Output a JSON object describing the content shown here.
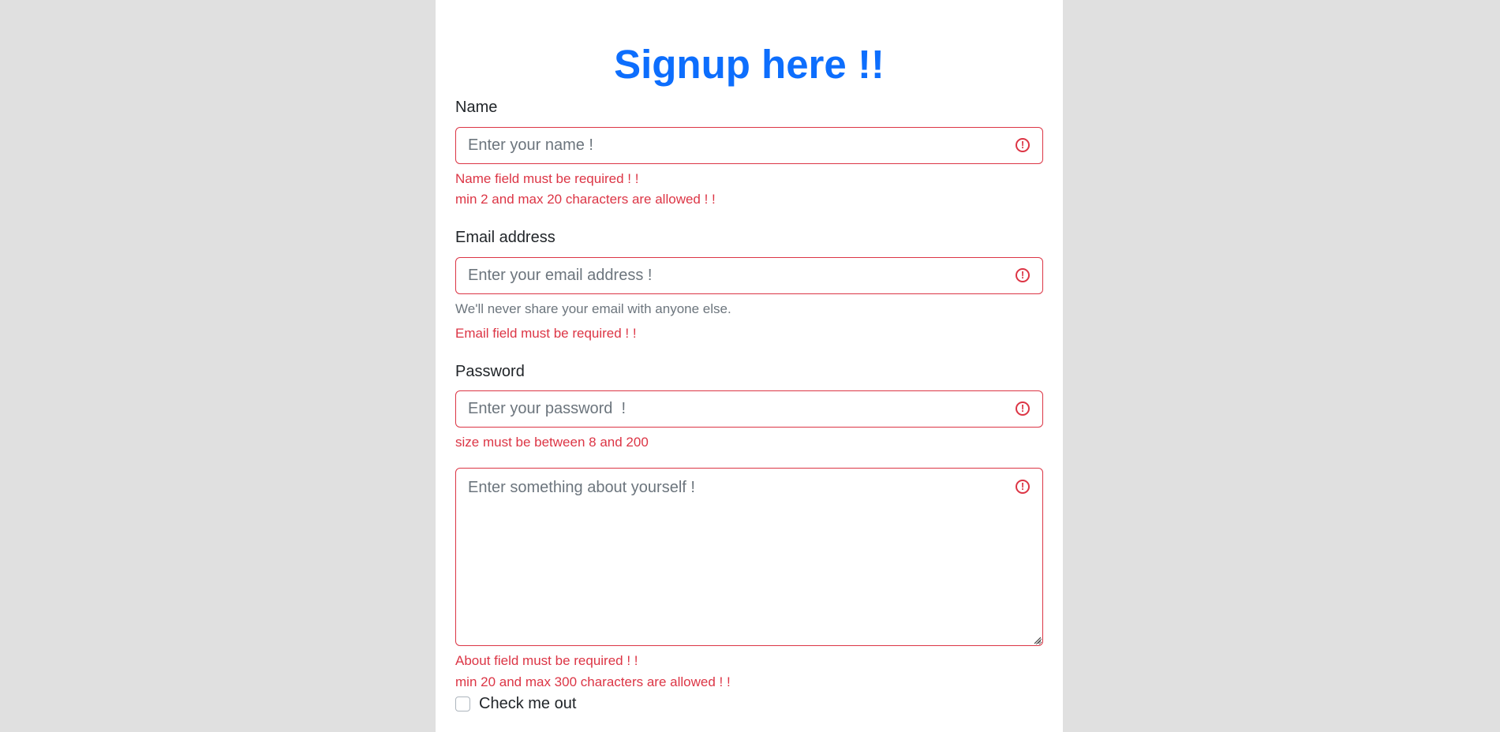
{
  "form": {
    "title": "Signup here !!",
    "name": {
      "label": "Name",
      "placeholder": "Enter your name !",
      "errors": [
        "Name field must be required ! !",
        "min 2 and max 20 characters are allowed ! !"
      ]
    },
    "email": {
      "label": "Email address",
      "placeholder": "Enter your email address !",
      "hint": "We'll never share your email with anyone else.",
      "errors": [
        "Email field must be required ! !"
      ]
    },
    "password": {
      "label": "Password",
      "placeholder": "Enter your password  !",
      "errors": [
        "size must be between 8 and 200"
      ]
    },
    "about": {
      "placeholder": "Enter something about yourself !",
      "errors": [
        "About field must be required ! !",
        "min 20 and max 300 characters are allowed ! !"
      ]
    },
    "checkbox": {
      "label": "Check me out",
      "checked": false
    },
    "invalid_icon": "exclamation-circle-icon"
  },
  "colors": {
    "page_bg": "#e0e0e0",
    "card_bg": "#ffffff",
    "title": "#0d6efd",
    "error": "#dc3545",
    "muted": "#6c757d"
  }
}
